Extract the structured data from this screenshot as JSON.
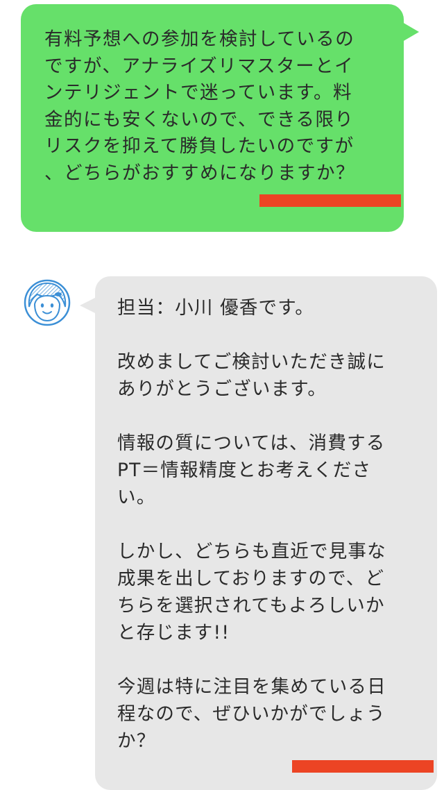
{
  "outgoing": {
    "text": "有料予想への参加を検討しているの\nですが、アナライズリマスターとイ\nンテリジェントで迷っています。料\n金的にも安くないので、できる限り\nリスクを抑えて勝負したいのですが\n、どちらがおすすめになりますか？"
  },
  "incoming": {
    "paragraphs": [
      "担当：小川 優香です。",
      "改めましてご検討いただき誠に\nありがとうございます。",
      "情報の質については、消費する\nPT＝情報精度とお考えくださ\nい。",
      "しかし、どちらも直近で見事な\n成果を出しておりますので、ど\nちらを選択されてもよろしいか\nと存じます!!",
      "今週は特に注目を集めている日\n程なので、ぜひいかがでしょう\nか？"
    ]
  },
  "colors": {
    "outgoing_bubble": "#66e06a",
    "incoming_bubble": "#e7e7e7",
    "redaction": "#ec4424",
    "avatar_accent": "#3b8fd6"
  },
  "icons": {
    "avatar": "female-operator-avatar-icon"
  }
}
